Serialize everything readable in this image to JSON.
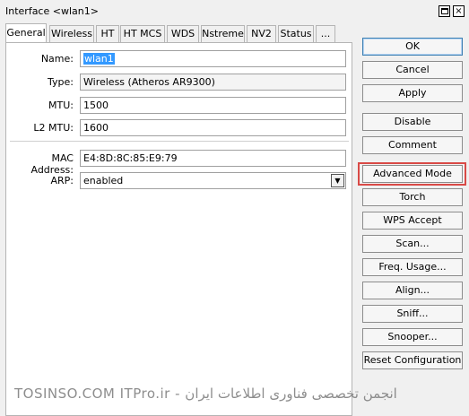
{
  "window": {
    "title": "Interface <wlan1>",
    "restore_icon": "restore-icon",
    "close_glyph": "×"
  },
  "tabs": [
    {
      "label": "General",
      "active": true
    },
    {
      "label": "Wireless"
    },
    {
      "label": "HT"
    },
    {
      "label": "HT MCS"
    },
    {
      "label": "WDS"
    },
    {
      "label": "Nstreme"
    },
    {
      "label": "NV2"
    },
    {
      "label": "Status"
    },
    {
      "label": "..."
    }
  ],
  "form": {
    "name": {
      "label": "Name:",
      "value": "wlan1"
    },
    "type": {
      "label": "Type:",
      "value": "Wireless (Atheros AR9300)"
    },
    "mtu": {
      "label": "MTU:",
      "value": "1500"
    },
    "l2mtu": {
      "label": "L2 MTU:",
      "value": "1600"
    },
    "mac": {
      "label": "MAC Address:",
      "value": "E4:8D:8C:85:E9:79"
    },
    "arp": {
      "label": "ARP:",
      "value": "enabled"
    }
  },
  "buttons": {
    "ok": "OK",
    "cancel": "Cancel",
    "apply": "Apply",
    "disable": "Disable",
    "comment": "Comment",
    "advanced_mode": "Advanced Mode",
    "torch": "Torch",
    "wps_accept": "WPS Accept",
    "scan": "Scan...",
    "freq_usage": "Freq. Usage...",
    "align": "Align...",
    "sniff": "Sniff...",
    "snooper": "Snooper...",
    "reset_configuration": "Reset Configuration"
  },
  "watermark": "TOSINSO.COM    ITPro.ir - انجمن تخصصی فناوری اطلاعات ایران",
  "colors": {
    "highlight": "#d94a46",
    "selection": "#3399ff"
  }
}
